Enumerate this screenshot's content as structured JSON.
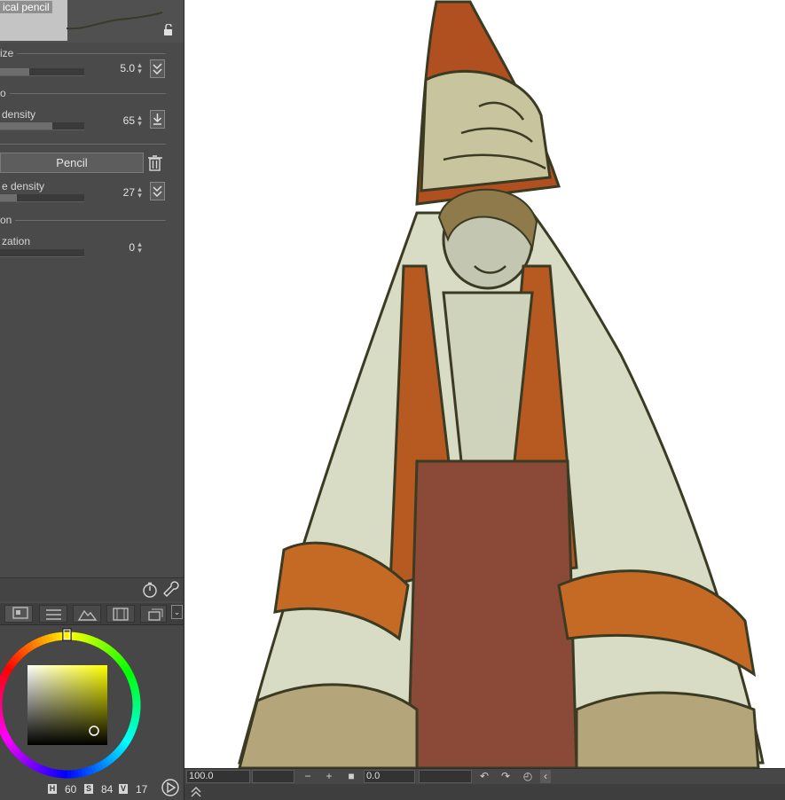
{
  "tool_property": {
    "brush_name": "ical pencil",
    "sections": {
      "size_title": "ize",
      "density_title": "o",
      "correction_title": "on"
    },
    "brush_size": {
      "label": "",
      "value": "5.0",
      "fill_fraction": 0.33
    },
    "density": {
      "label": "density",
      "value": "65",
      "fill_fraction": 0.62
    },
    "pencil_button": "Pencil",
    "texture_density": {
      "label": "e density",
      "value": "27",
      "fill_fraction": 0.2
    },
    "stabilization": {
      "label": "zation",
      "value": "0",
      "fill_fraction": 0.0
    }
  },
  "color_panel": {
    "hue_tag": "H",
    "hue": "60",
    "sat_tag": "S",
    "sat": "84",
    "val_tag": "V",
    "val": "17",
    "current_hue_color": "#ffff00"
  },
  "status_bar": {
    "zoom": "100.0",
    "rotation": "0.0"
  },
  "icons": {
    "lock": "lock-open-icon",
    "trash": "trash-icon",
    "settings": "wrench-icon",
    "stopwatch": "stopwatch-icon"
  }
}
